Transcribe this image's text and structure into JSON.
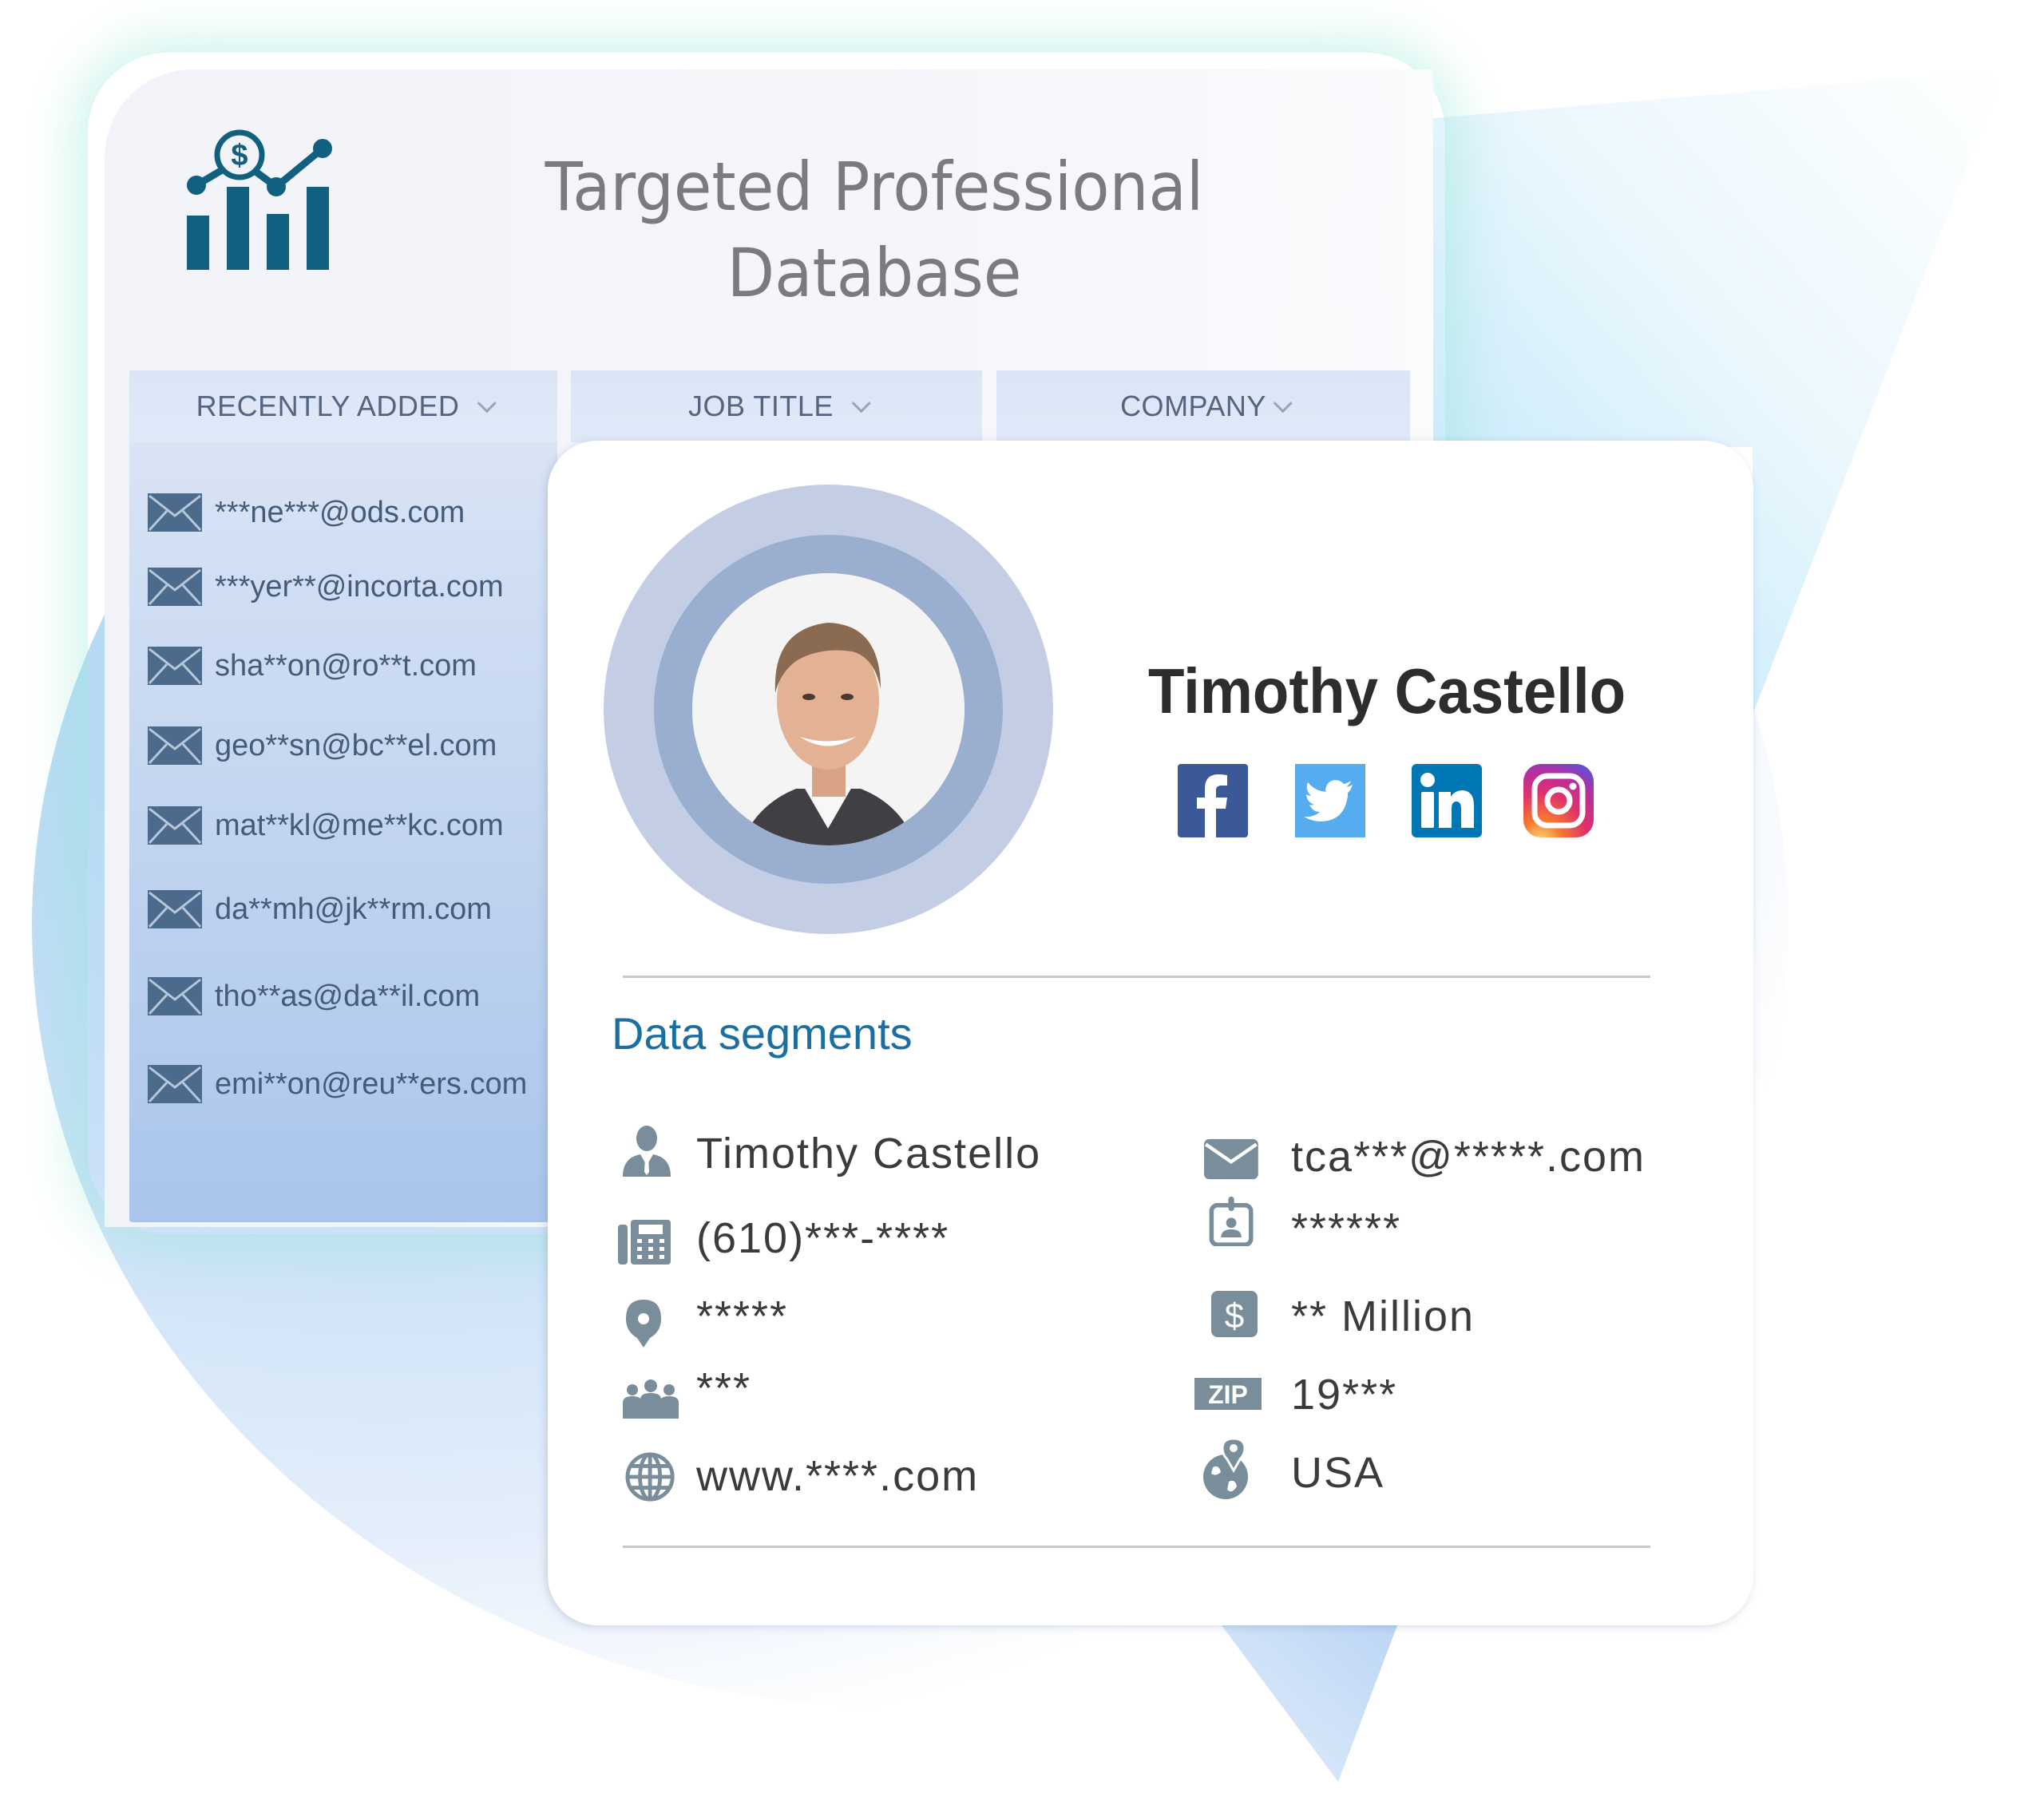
{
  "header": {
    "title_line1": "Targeted Professional",
    "title_line2": "Database",
    "logo_icon": "chart-dollar-icon"
  },
  "tabs": [
    {
      "label": "RECENTLY ADDED",
      "icon": "chevron-down-icon"
    },
    {
      "label": "JOB TITLE",
      "icon": "chevron-down-icon"
    },
    {
      "label": "COMPANY",
      "icon": "chevron-down-icon"
    }
  ],
  "email_list": [
    "***ne***@ods.com",
    "***yer**@incorta.com",
    "sha**on@ro**t.com",
    "geo**sn@bc**el.com",
    "mat**kl@me**kc.com",
    "da**mh@jk**rm.com",
    "tho**as@da**il.com",
    "emi**on@reu**ers.com"
  ],
  "profile": {
    "name": "Timothy Castello",
    "avatar": "profile-photo",
    "social": [
      {
        "name": "facebook",
        "color": "#3b5998"
      },
      {
        "name": "twitter",
        "color": "#55acee"
      },
      {
        "name": "linkedin",
        "color": "#0077b5"
      },
      {
        "name": "instagram",
        "color": "#c13584"
      }
    ]
  },
  "data_segments": {
    "title": "Data segments",
    "left": [
      {
        "icon": "person-icon",
        "value": "Timothy Castello"
      },
      {
        "icon": "phone-icon",
        "value": "(610)***-****"
      },
      {
        "icon": "location-pin-icon",
        "value": "*****"
      },
      {
        "icon": "team-icon",
        "value": "***"
      },
      {
        "icon": "globe-icon",
        "value": "www.****.com"
      }
    ],
    "right": [
      {
        "icon": "envelope-icon",
        "value": "tca***@*****.com"
      },
      {
        "icon": "id-badge-icon",
        "value": "******"
      },
      {
        "icon": "dollar-icon",
        "value": "** Million"
      },
      {
        "icon": "zip-icon",
        "value": "19***"
      },
      {
        "icon": "globe-pin-icon",
        "value": "USA"
      }
    ]
  },
  "colors": {
    "accent": "#1a6fa0",
    "logo": "#11607f",
    "icon_gray": "#7a8d9a",
    "email_icon": "#4c6a8c"
  }
}
